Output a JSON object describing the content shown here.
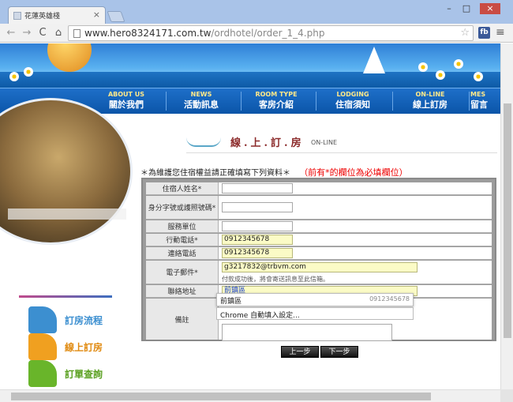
{
  "browser": {
    "tab_title": "花蓮英雄棧",
    "url_host": "www.hero8324171.com.tw",
    "url_path": "/ordhotel/order_1_4.php",
    "tab_close": "×",
    "back": "←",
    "forward": "→",
    "reload": "C",
    "home": "⌂",
    "star": "☆",
    "fb_label": "fb",
    "menu": "≡",
    "minimize": "–",
    "maximize": "□",
    "close": "×"
  },
  "nav": [
    {
      "en": "ABOUT US",
      "zh": "關於我們"
    },
    {
      "en": "NEWS",
      "zh": "活動訊息"
    },
    {
      "en": "ROOM TYPE",
      "zh": "客房介紹"
    },
    {
      "en": "LODGING",
      "zh": "住宿須知"
    },
    {
      "en": "ON-LINE",
      "zh": "線上訂房"
    },
    {
      "en": "MES",
      "zh": "留言"
    }
  ],
  "sidebar": {
    "links": [
      {
        "label": "訂房流程",
        "color": "#3c8fd0",
        "text_color": "#3c8fd0"
      },
      {
        "label": "線上訂房",
        "color": "#f0a020",
        "text_color": "#e08a10"
      },
      {
        "label": "訂單查詢",
        "color": "#69b52a",
        "text_color": "#5aa020"
      }
    ]
  },
  "page": {
    "title_zh": "線.上.訂.房",
    "title_en": "ON-LINE",
    "notice": "＊為維護您住宿權益請正確填寫下列資料＊",
    "required_note": "（前有*的欄位為必填欄位）"
  },
  "form": {
    "name_label": "住宿人姓名*",
    "id_label": "身分字號或護照號碼*",
    "company_label": "服務單位",
    "mobile_label": "行動電話*",
    "mobile_value": "0912345678",
    "phone_label": "連絡電話",
    "phone_value": "0912345678",
    "email_label": "電子郵件*",
    "email_value": "g3217832@trbvm.com",
    "email_hint": "付款成功後，將會寄送訊息至此信箱。",
    "address_label": "聯絡地址",
    "address_value": "前鎮區",
    "autofill_name": "前鎮區",
    "autofill_phone": "0912345678",
    "autofill_settings": "Chrome 自動填入設定...",
    "note_label": "備註"
  },
  "buttons": {
    "prev": "上一步",
    "next": "下一步"
  }
}
